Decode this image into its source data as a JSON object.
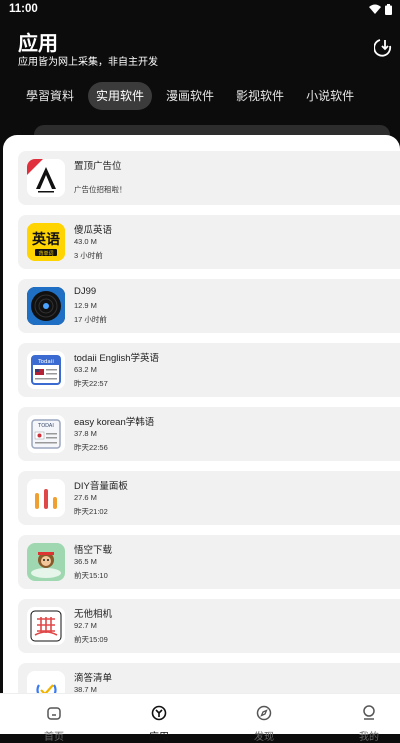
{
  "status_bar": {
    "time": "11:00"
  },
  "header": {
    "title": "应用",
    "subtitle": "应用皆为网上采集，非自主开发"
  },
  "tabs": [
    {
      "label": "學習資料"
    },
    {
      "label": "实用软件",
      "active": true
    },
    {
      "label": "漫画软件"
    },
    {
      "label": "影视软件"
    },
    {
      "label": "小说软件"
    }
  ],
  "ad": {
    "name": "置顶广告位",
    "subtitle": "广告位招租啦！",
    "logo_text": "A"
  },
  "apps": [
    {
      "name": "傻瓜英语",
      "size": "43.0 M",
      "time": "3 小时前",
      "icon": "english-app-icon"
    },
    {
      "name": "DJ99",
      "size": "12.9 M",
      "time": "17 小时前",
      "icon": "vinyl-record-icon"
    },
    {
      "name": "todaii English学英语",
      "size": "63.2 M",
      "time": "昨天22:57",
      "icon": "todaii-english-icon"
    },
    {
      "name": "easy korean学韩语",
      "size": "37.8 M",
      "time": "昨天22:56",
      "icon": "todaii-korean-icon"
    },
    {
      "name": "DIY音量面板",
      "size": "27.6 M",
      "time": "昨天21:02",
      "icon": "volume-bars-icon"
    },
    {
      "name": "悟空下载",
      "size": "36.5 M",
      "time": "前天15:10",
      "icon": "wukong-icon"
    },
    {
      "name": "无他相机",
      "size": "92.7 M",
      "time": "前天15:09",
      "icon": "camera-grid-icon"
    },
    {
      "name": "滴答清单",
      "size": "38.7 M",
      "time": "",
      "icon": "checkmark-icon"
    }
  ],
  "icon_labels": {
    "english_char": "英语",
    "english_sub": "背单词",
    "todaii": "Todaii",
    "todai": "TODAI"
  },
  "bottom_nav": [
    {
      "label": "首页",
      "icon": "home-icon"
    },
    {
      "label": "应用",
      "icon": "apps-icon",
      "active": true
    },
    {
      "label": "发现",
      "icon": "compass-icon"
    },
    {
      "label": "我的",
      "icon": "profile-icon"
    }
  ],
  "colors": {
    "background": "#0c0c0c",
    "sheet": "#ffffff",
    "card": "#f1f1f1",
    "active_tab": "#3b3b3b",
    "ad_red": "#e0303e",
    "dj_blue": "#1f6fc4",
    "english_yellow": "#ffd400"
  }
}
